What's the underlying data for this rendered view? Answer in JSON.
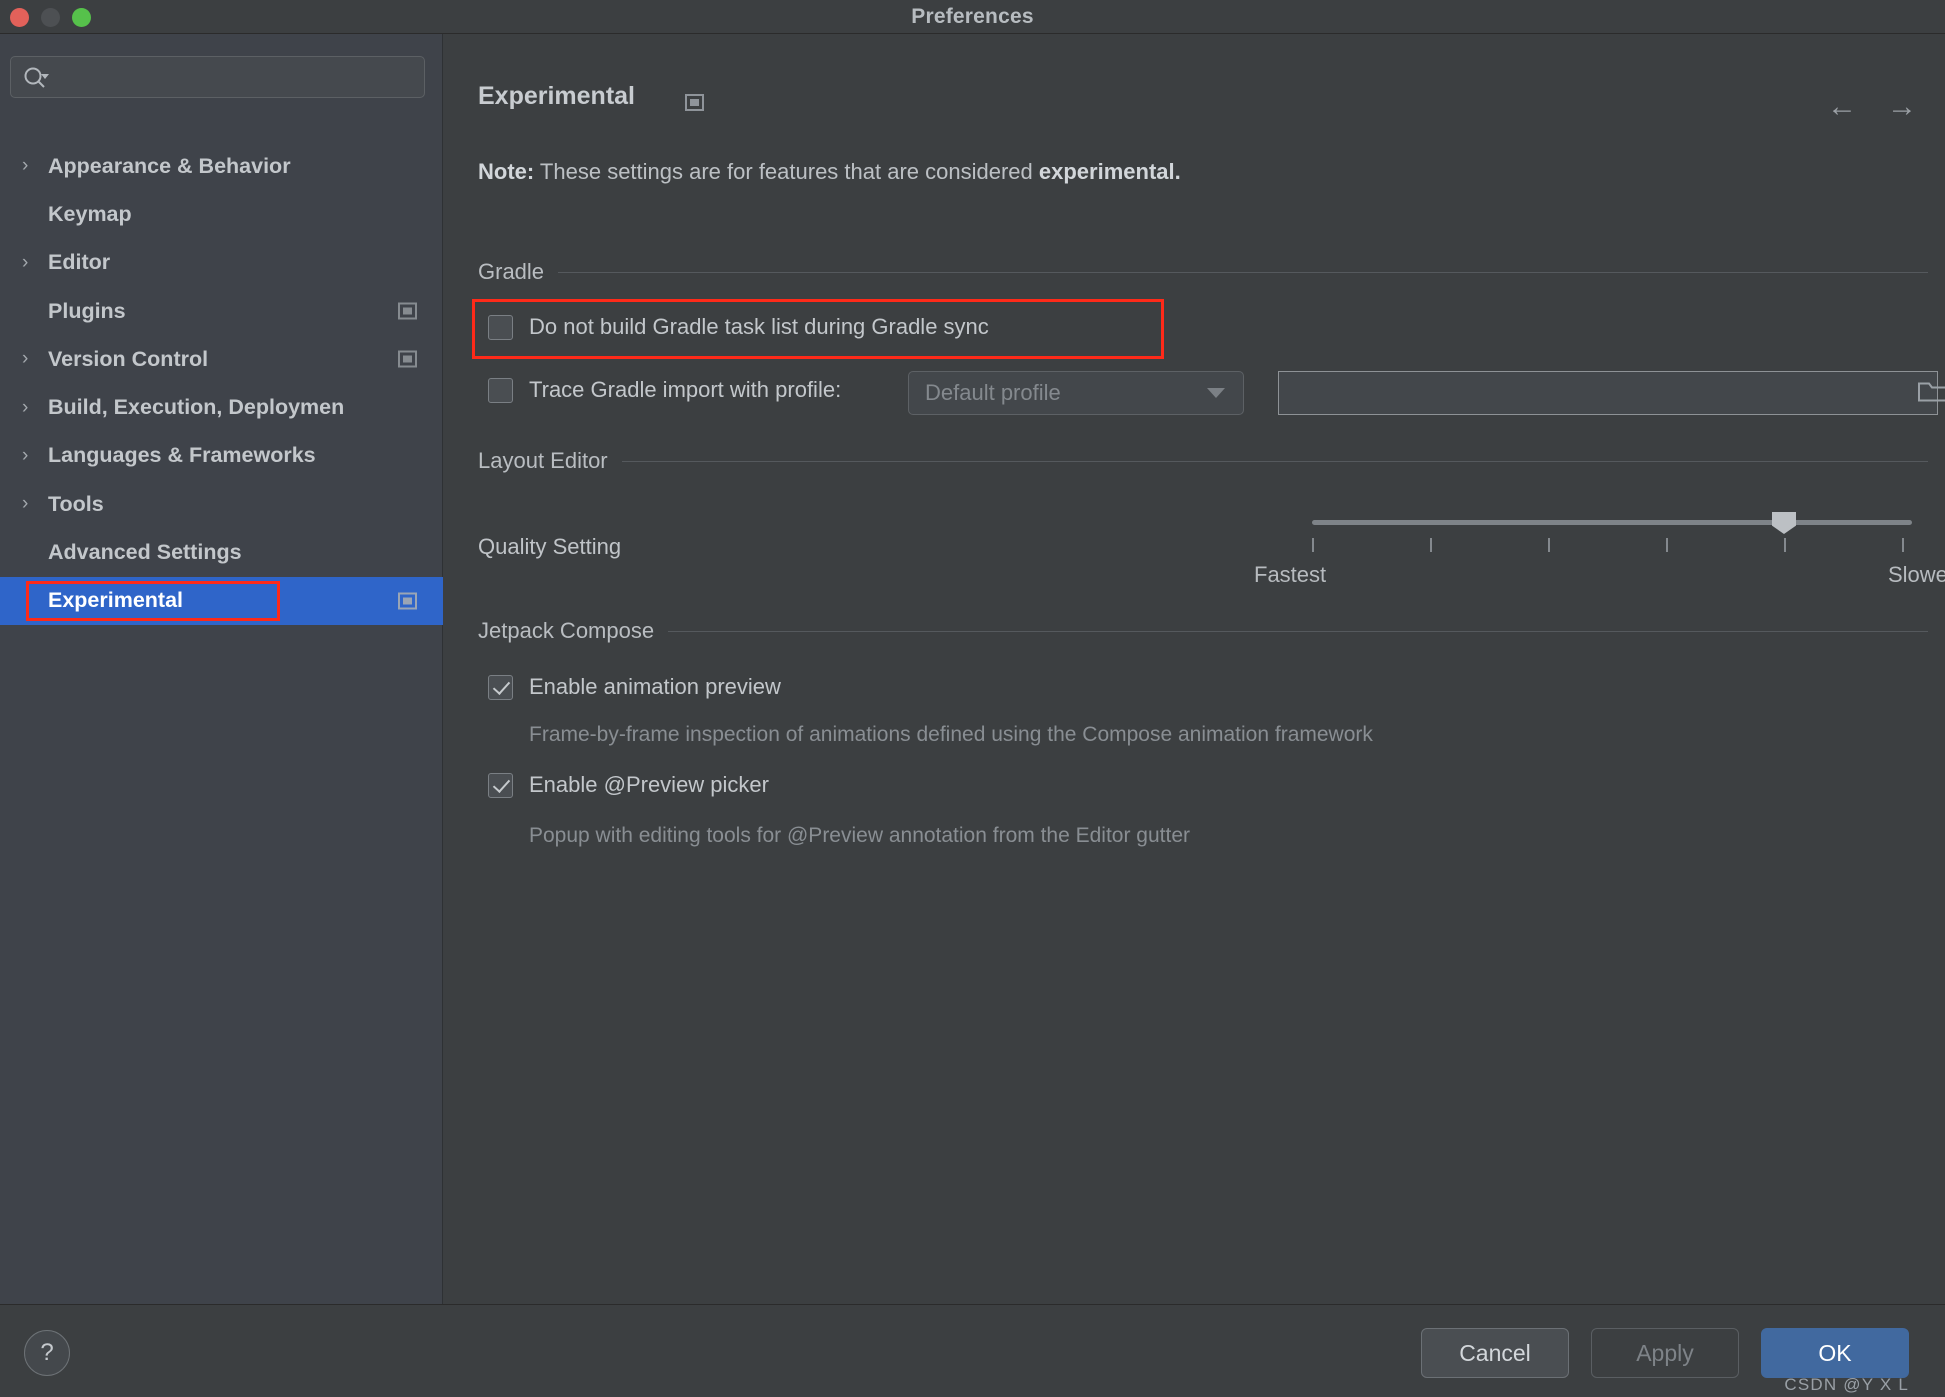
{
  "window": {
    "title": "Preferences",
    "controls": [
      "close",
      "minimize",
      "zoom"
    ]
  },
  "sidebar": {
    "search": {
      "value": "",
      "placeholder": ""
    },
    "items": [
      {
        "label": "Appearance & Behavior",
        "expandable": true,
        "selected": false,
        "badge": false
      },
      {
        "label": "Keymap",
        "expandable": false,
        "selected": false,
        "badge": false
      },
      {
        "label": "Editor",
        "expandable": true,
        "selected": false,
        "badge": false
      },
      {
        "label": "Plugins",
        "expandable": false,
        "selected": false,
        "badge": true
      },
      {
        "label": "Version Control",
        "expandable": true,
        "selected": false,
        "badge": true
      },
      {
        "label": "Build, Execution, Deploymen",
        "expandable": true,
        "selected": false,
        "badge": false
      },
      {
        "label": "Languages & Frameworks",
        "expandable": true,
        "selected": false,
        "badge": false
      },
      {
        "label": "Tools",
        "expandable": true,
        "selected": false,
        "badge": false
      },
      {
        "label": "Advanced Settings",
        "expandable": false,
        "selected": false,
        "badge": false
      },
      {
        "label": "Experimental",
        "expandable": false,
        "selected": true,
        "badge": true
      }
    ]
  },
  "main": {
    "page_title": "Experimental",
    "note_prefix": "Note:",
    "note_text": " These settings are for features that are considered ",
    "note_emphasis": "experimental.",
    "sections": {
      "gradle": {
        "title": "Gradle",
        "do_not_build": {
          "label": "Do not build Gradle task list during Gradle sync",
          "checked": false,
          "highlighted": true
        },
        "trace": {
          "label": "Trace Gradle import with profile:",
          "checked": false,
          "profile_value": "Default profile",
          "path_value": ""
        }
      },
      "layout_editor": {
        "title": "Layout Editor",
        "quality_label": "Quality Setting",
        "slider": {
          "min_label": "Fastest",
          "max_label": "Slowest",
          "ticks": 6,
          "value_percent": 90
        }
      },
      "jetpack_compose": {
        "title": "Jetpack Compose",
        "options": [
          {
            "label": "Enable animation preview",
            "checked": true,
            "hint": "Frame-by-frame inspection of animations defined using the Compose animation framework"
          },
          {
            "label": "Enable @Preview picker",
            "checked": true,
            "hint": "Popup with editing tools for @Preview annotation from the Editor gutter"
          }
        ]
      }
    },
    "nav": {
      "back": "←",
      "forward": "→"
    }
  },
  "footer": {
    "help_label": "?",
    "cancel_label": "Cancel",
    "apply_label": "Apply",
    "ok_label": "OK",
    "watermark": "CSDN @Y  X  L"
  },
  "colors": {
    "accent_selected": "#2f65c9",
    "accent_ok": "#41699f",
    "highlight_red": "#fe2a19",
    "bg_window": "#3c3f41",
    "bg_sidebar": "#3f434a"
  }
}
